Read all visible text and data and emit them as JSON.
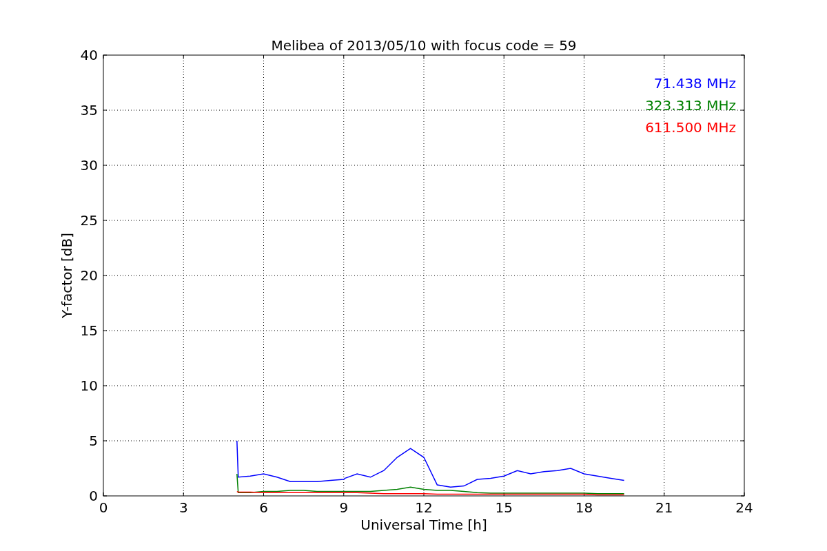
{
  "chart_data": {
    "type": "line",
    "title": "Melibea of 2013/05/10 with focus code = 59",
    "xlabel": "Universal Time [h]",
    "ylabel": "Y-factor [dB]",
    "x": [
      5,
      5.05,
      5.5,
      6,
      6.5,
      7,
      7.5,
      8,
      8.5,
      9,
      9.05,
      9.5,
      10,
      10.5,
      11,
      11.5,
      12,
      12.5,
      13,
      13.5,
      14,
      14.5,
      15,
      15.5,
      16,
      16.5,
      17,
      17.5,
      18,
      18.5,
      19,
      19.5
    ],
    "series": [
      {
        "name": "71.438 MHz",
        "color": "#0000ff",
        "values": [
          5,
          1.7,
          1.8,
          2.0,
          1.7,
          1.3,
          1.3,
          1.3,
          1.4,
          1.5,
          1.6,
          2.0,
          1.7,
          2.3,
          3.5,
          4.3,
          3.5,
          1.0,
          0.8,
          0.9,
          1.5,
          1.6,
          1.8,
          2.3,
          2.0,
          2.2,
          2.3,
          2.5,
          2.0,
          1.8,
          1.6,
          1.4
        ]
      },
      {
        "name": "323.313 MHz",
        "color": "#008000",
        "values": [
          2,
          0.3,
          0.3,
          0.4,
          0.4,
          0.5,
          0.5,
          0.4,
          0.4,
          0.4,
          0.4,
          0.4,
          0.4,
          0.5,
          0.6,
          0.8,
          0.6,
          0.5,
          0.5,
          0.4,
          0.3,
          0.25,
          0.25,
          0.25,
          0.25,
          0.25,
          0.25,
          0.25,
          0.25,
          0.2,
          0.2,
          0.2
        ]
      },
      {
        "name": "611.500 MHz",
        "color": "#ff0000",
        "values": [
          0.4,
          0.35,
          0.35,
          0.3,
          0.3,
          0.3,
          0.3,
          0.3,
          0.3,
          0.3,
          0.3,
          0.3,
          0.25,
          0.2,
          0.2,
          0.2,
          0.2,
          0.15,
          0.15,
          0.15,
          0.15,
          0.15,
          0.15,
          0.15,
          0.15,
          0.15,
          0.15,
          0.15,
          0.15,
          0.1,
          0.1,
          0.1
        ]
      }
    ],
    "xlim": [
      0,
      24
    ],
    "ylim": [
      0,
      40
    ],
    "xticks": [
      0,
      3,
      6,
      9,
      12,
      15,
      18,
      21,
      24
    ],
    "yticks": [
      0,
      5,
      10,
      15,
      20,
      25,
      30,
      35,
      40
    ],
    "grid": true
  }
}
